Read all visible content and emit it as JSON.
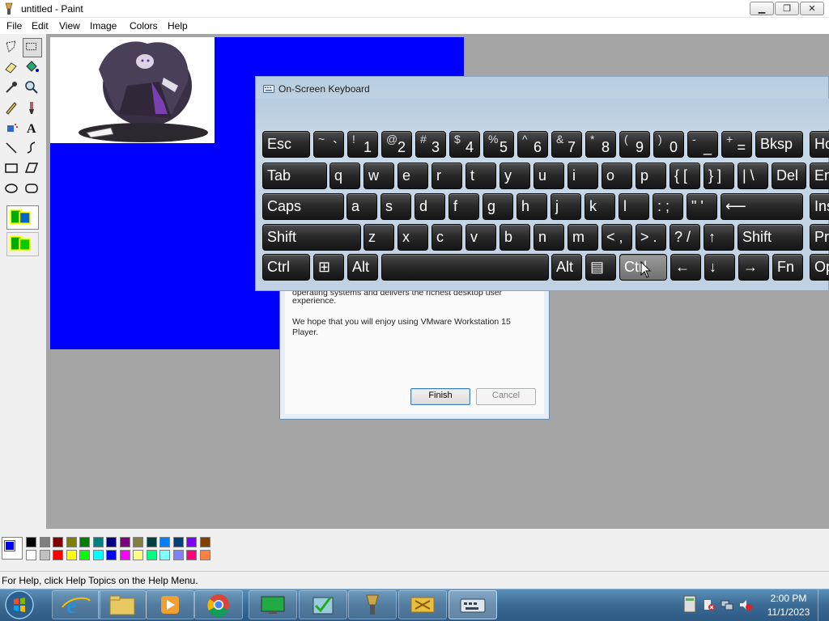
{
  "paint": {
    "title": "untitled - Paint",
    "menu": [
      "File",
      "Edit",
      "View",
      "Image",
      "Colors",
      "Help"
    ],
    "status": "For Help, click Help Topics on the Help Menu.",
    "window_buttons": {
      "minimize": "▁",
      "restore": "❐",
      "close": "✕"
    },
    "tools": [
      "free-select-icon",
      "rect-select-icon",
      "eraser-icon",
      "fill-bucket-icon",
      "color-picker-icon",
      "magnifier-icon",
      "pencil-icon",
      "brush-icon",
      "airbrush-icon",
      "text-icon",
      "line-icon",
      "curve-icon",
      "rectangle-icon",
      "polygon-icon",
      "ellipse-icon",
      "rounded-rect-icon"
    ],
    "palette": {
      "foreground": "#0000fe",
      "background": "#ffffff",
      "row1": [
        "#000000",
        "#808080",
        "#800000",
        "#808000",
        "#008000",
        "#008080",
        "#000080",
        "#800080",
        "#808040",
        "#004040",
        "#0080ff",
        "#004080",
        "#8000ff",
        "#804000"
      ],
      "row2": [
        "#ffffff",
        "#c0c0c0",
        "#ff0000",
        "#ffff00",
        "#00ff00",
        "#00ffff",
        "#0000ff",
        "#ff00ff",
        "#ffff80",
        "#00ff80",
        "#80ffff",
        "#8080ff",
        "#ff0080",
        "#ff8040"
      ]
    }
  },
  "dialog": {
    "partial_line": "operating systems and delivers the richest desktop user",
    "line2": "experience.",
    "line3": "We hope that you will enjoy using VMware Workstation 15",
    "line4": "Player.",
    "finish": "Finish",
    "cancel": "Cancel"
  },
  "osk": {
    "title": "On-Screen Keyboard",
    "row1": [
      {
        "label": "Esc"
      },
      {
        "shift": "~",
        "base": "`"
      },
      {
        "shift": "!",
        "base": "1"
      },
      {
        "shift": "@",
        "base": "2"
      },
      {
        "shift": "#",
        "base": "3"
      },
      {
        "shift": "$",
        "base": "4"
      },
      {
        "shift": "%",
        "base": "5"
      },
      {
        "shift": "^",
        "base": "6"
      },
      {
        "shift": "&",
        "base": "7"
      },
      {
        "shift": "*",
        "base": "8"
      },
      {
        "shift": "(",
        "base": "9"
      },
      {
        "shift": ")",
        "base": "0"
      },
      {
        "shift": "-",
        "base": "_"
      },
      {
        "shift": "+",
        "base": "="
      },
      {
        "label": "Bksp"
      },
      {
        "label": "Ho"
      }
    ],
    "row2": [
      "Tab",
      "q",
      "w",
      "e",
      "r",
      "t",
      "y",
      "u",
      "i",
      "o",
      "p",
      "{ [",
      "} ]",
      "| \\",
      "Del",
      "En"
    ],
    "row3": [
      "Caps",
      "a",
      "s",
      "d",
      "f",
      "g",
      "h",
      "j",
      "k",
      "l",
      ": ;",
      "\" '",
      "⟵",
      "Ins"
    ],
    "row4": [
      "Shift",
      "z",
      "x",
      "c",
      "v",
      "b",
      "n",
      "m",
      "< ,",
      "> .",
      "? /",
      "↑",
      "Shift",
      "Pr"
    ],
    "row5": [
      "Ctrl",
      "⊞",
      "Alt",
      "",
      "Alt",
      "▤",
      "Ctrl",
      "←",
      "↓",
      "→",
      "Fn",
      "Op"
    ]
  },
  "taskbar": {
    "time": "2:00 PM",
    "date": "11/1/2023",
    "apps": [
      "start-orb",
      "internet-explorer",
      "file-explorer",
      "media-player",
      "chrome",
      "vmware-monitor",
      "vmware-player",
      "paint",
      "network-app",
      "on-screen-keyboard"
    ]
  }
}
